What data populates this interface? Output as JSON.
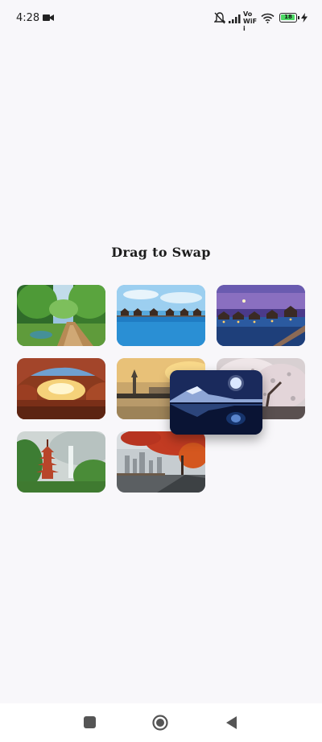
{
  "status": {
    "time": "4:28",
    "network": "Vo WiFi",
    "battery": "18"
  },
  "title": "Drag to Swap",
  "images": [
    {
      "name": "forest-path"
    },
    {
      "name": "overwater-bungalows-day"
    },
    {
      "name": "overwater-bungalows-dusk"
    },
    {
      "name": "rock-arch-sunset"
    },
    {
      "name": "bridge-city-sunset"
    },
    {
      "name": "blossom-tree"
    },
    {
      "name": "pagoda-waterfall"
    },
    {
      "name": "autumn-city-road"
    },
    {
      "name": "mountain-lake-moon"
    }
  ],
  "nav": {
    "recents": "recents-square-icon",
    "home": "home-circle-icon",
    "back": "back-triangle-icon"
  }
}
